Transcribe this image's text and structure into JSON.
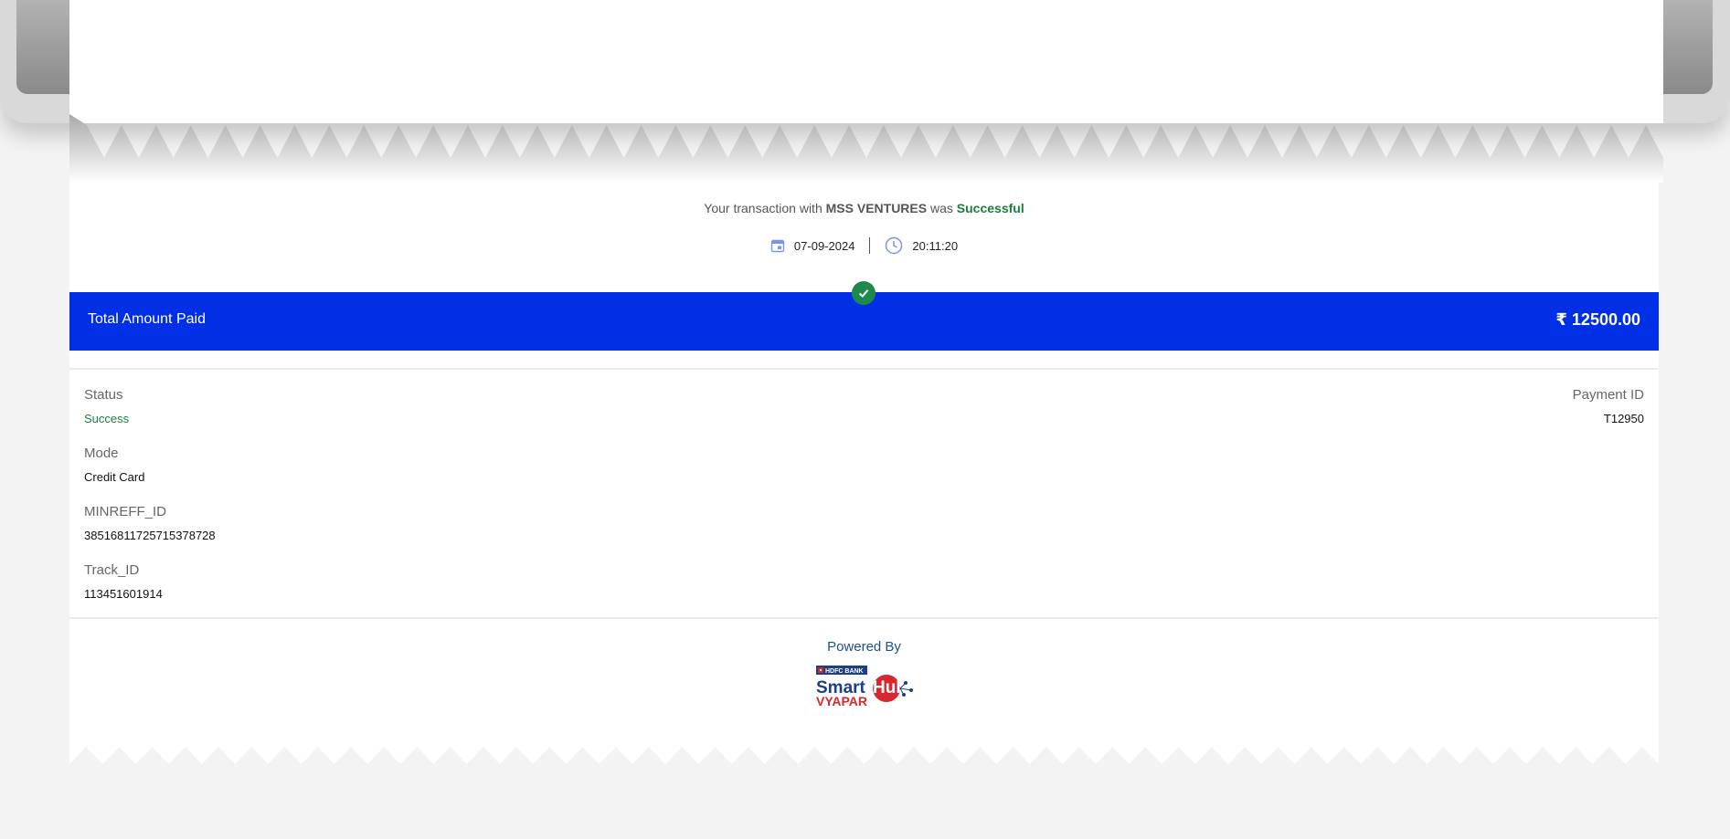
{
  "transaction": {
    "prefix": "Your transaction with",
    "merchant": "MSS VENTURES",
    "was": "was",
    "status_word": "Successful",
    "date": "07-09-2024",
    "time": "20:11:20"
  },
  "amount": {
    "label": "Total Amount Paid",
    "value": "₹ 12500.00"
  },
  "details": {
    "status_label": "Status",
    "status_value": "Success",
    "payment_id_label": "Payment ID",
    "payment_id_value": "T12950",
    "mode_label": "Mode",
    "mode_value": "Credit Card",
    "minreff_label": "MINREFF_ID",
    "minreff_value": "38516811725715378728",
    "track_label": "Track_ID",
    "track_value": "113451601914"
  },
  "footer": {
    "powered_by": "Powered By",
    "logo_bank": "HDFC BANK",
    "logo_smart": "Smart",
    "logo_hub": "Hub",
    "logo_vyapar": "VYAPAR"
  },
  "colors": {
    "accent_blue": "#002fe6",
    "success_green": "#1a7f3a",
    "background": "#f3f3f3"
  }
}
